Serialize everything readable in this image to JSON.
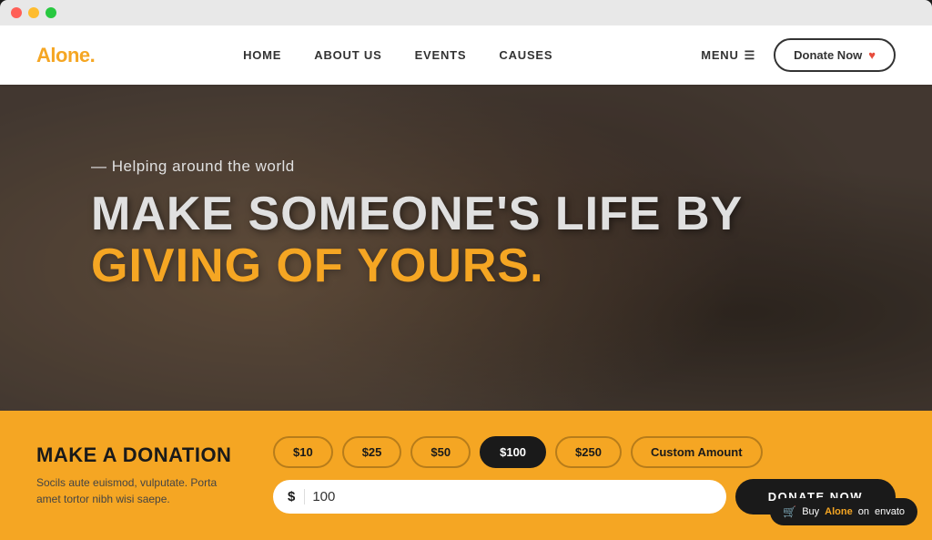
{
  "window": {
    "dots": [
      "red",
      "yellow",
      "green"
    ]
  },
  "navbar": {
    "logo": "Alone",
    "logo_dot": ".",
    "links": [
      {
        "label": "HOME",
        "id": "home"
      },
      {
        "label": "ABOUT US",
        "id": "about-us"
      },
      {
        "label": "EVENTS",
        "id": "events"
      },
      {
        "label": "CAUSES",
        "id": "causes"
      }
    ],
    "menu_label": "MENU",
    "donate_button": "Donate Now"
  },
  "hero": {
    "subtitle": "Helping around the world",
    "title_line1": "MAKE SOMEONE'S LIFE BY",
    "title_line2": "GIVING OF YOURS."
  },
  "donation_widget": {
    "title": "MAKE A DONATION",
    "description": "Socils aute euismod, vulputate. Porta amet tortor nibh wisi saepe.",
    "amounts": [
      "$10",
      "$25",
      "$50",
      "$100",
      "$250",
      "Custom Amount"
    ],
    "active_amount": "$100",
    "currency_symbol": "$",
    "input_value": "100",
    "donate_button": "DONATE NOW"
  },
  "envato": {
    "text_prefix": "Buy",
    "brand": "Alone",
    "text_suffix": "on",
    "marketplace": "envato"
  }
}
